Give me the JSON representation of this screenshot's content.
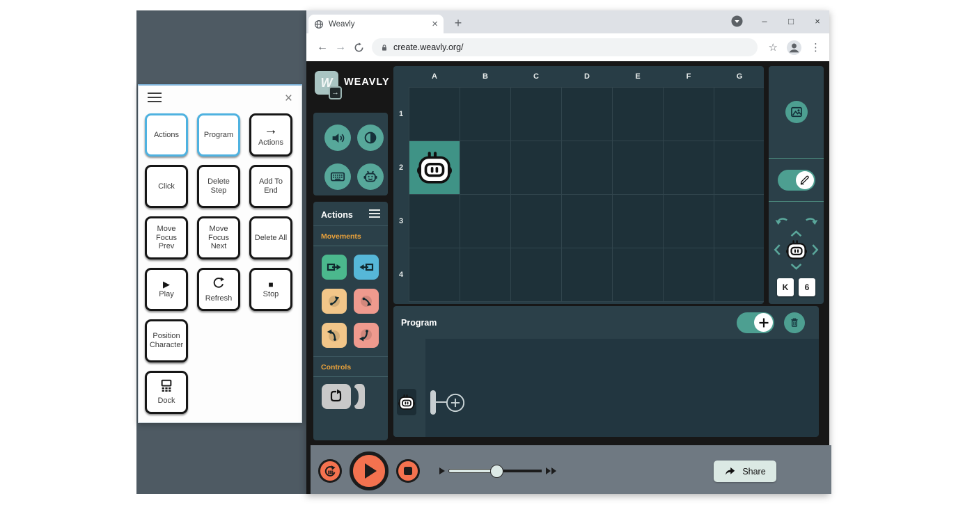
{
  "colors": {
    "teal_accent": "#4d9f91",
    "panel_slate": "#2b4049",
    "scene_cell": "#1e3139",
    "highlight_cell": "#3f9386",
    "orange_accent": "#f4724f",
    "switch_highlight_blue": "#4fb2e0",
    "section_label_amber": "#e9a13b",
    "movement_green": "#4bb88d",
    "movement_blue": "#56b7d8",
    "movement_yellow": "#f2c689",
    "movement_pink": "#ef9a8e",
    "bottom_bar_gray": "#6f7982"
  },
  "switch_panel": {
    "close_icon": "×",
    "buttons": [
      {
        "label": "Actions",
        "variant": "blue"
      },
      {
        "label": "Program",
        "variant": "blue"
      },
      {
        "label": "Actions",
        "variant": "black",
        "icon_text": "→"
      },
      {
        "label": "Click"
      },
      {
        "label": "Delete Step"
      },
      {
        "label": "Add To End"
      },
      {
        "label": "Move Focus Prev"
      },
      {
        "label": "Move Focus Next"
      },
      {
        "label": "Delete All"
      },
      {
        "label": "Play",
        "icon_text": "▶"
      },
      {
        "label": "Refresh"
      },
      {
        "label": "Stop",
        "icon_text": "■"
      },
      {
        "label": "Position Character"
      },
      {
        "label": "Dock"
      }
    ]
  },
  "browser": {
    "tab_title": "Weavly",
    "tab_close_icon": "×",
    "new_tab_icon": "+",
    "back_icon": "←",
    "forward_icon": "→",
    "url": "create.weavly.org/",
    "bookmark_icon": "☆",
    "menu_icon": "⋮",
    "minimize_icon": "–",
    "maximize_icon": "□",
    "close_icon": "×"
  },
  "app": {
    "logo_letter": "W",
    "logo_badge_icon": "→",
    "logo_text": "WEAVLY",
    "actions_panel": {
      "title": "Actions",
      "movements_label": "Movements",
      "controls_label": "Controls"
    },
    "scene": {
      "columns": [
        "A",
        "B",
        "C",
        "D",
        "E",
        "F",
        "G"
      ],
      "rows": [
        "1",
        "2",
        "3",
        "4"
      ],
      "character_cell": "A2"
    },
    "position_controls": {
      "column_value": "K",
      "row_value": "6"
    },
    "program": {
      "title": "Program"
    },
    "bottom_bar": {
      "share_label": "Share"
    }
  }
}
